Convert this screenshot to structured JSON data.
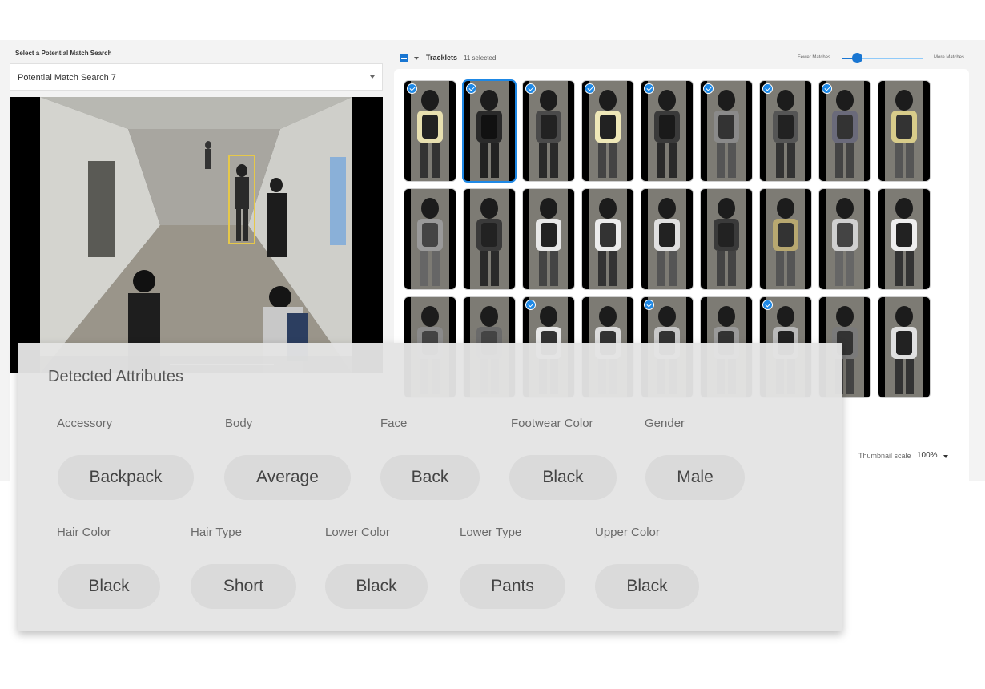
{
  "left_pane": {
    "select_label": "Select a Potential Match Search",
    "selected_search": "Potential Match Search 7"
  },
  "tracklets": {
    "title": "Tracklets",
    "selected_count": "11 selected",
    "fewer_label": "Fewer Matches",
    "more_label": "More Matches",
    "match_slider_level": 0.18,
    "thumbnail_scale_label": "Thumbnail scale",
    "thumbnail_scale_value": "100%",
    "thumbnails": [
      {
        "selected": true,
        "focused": false,
        "shirt": "#e8e0b0",
        "bag": "#222",
        "pants": "#333"
      },
      {
        "selected": true,
        "focused": true,
        "shirt": "#2a2a2a",
        "bag": "#111",
        "pants": "#222"
      },
      {
        "selected": true,
        "focused": false,
        "shirt": "#4a4a4a",
        "bag": "#222",
        "pants": "#2a2a2a"
      },
      {
        "selected": true,
        "focused": false,
        "shirt": "#efe8b8",
        "bag": "#222",
        "pants": "#444"
      },
      {
        "selected": true,
        "focused": false,
        "shirt": "#3a3a3a",
        "bag": "#1a1a1a",
        "pants": "#2a2a2a"
      },
      {
        "selected": true,
        "focused": false,
        "shirt": "#8a8a8a",
        "bag": "#333",
        "pants": "#555"
      },
      {
        "selected": true,
        "focused": false,
        "shirt": "#555",
        "bag": "#222",
        "pants": "#333"
      },
      {
        "selected": true,
        "focused": false,
        "shirt": "#6a6a7a",
        "bag": "#333",
        "pants": "#444"
      },
      {
        "selected": false,
        "focused": false,
        "shirt": "#d8cc8a",
        "bag": "#333",
        "pants": "#555"
      },
      {
        "selected": false,
        "focused": false,
        "shirt": "#9a9a9a",
        "bag": "#444",
        "pants": "#666"
      },
      {
        "selected": false,
        "focused": false,
        "shirt": "#3a3a3a",
        "bag": "#222",
        "pants": "#2a2a2a"
      },
      {
        "selected": false,
        "focused": false,
        "shirt": "#e8e8e8",
        "bag": "#222",
        "pants": "#444"
      },
      {
        "selected": false,
        "focused": false,
        "shirt": "#ececec",
        "bag": "#333",
        "pants": "#333"
      },
      {
        "selected": false,
        "focused": false,
        "shirt": "#e0e0e0",
        "bag": "#222",
        "pants": "#555"
      },
      {
        "selected": false,
        "focused": false,
        "shirt": "#3a3a3a",
        "bag": "#222",
        "pants": "#444"
      },
      {
        "selected": false,
        "focused": false,
        "shirt": "#b8a870",
        "bag": "#333",
        "pants": "#555"
      },
      {
        "selected": false,
        "focused": false,
        "shirt": "#d0d0d0",
        "bag": "#444",
        "pants": "#666"
      },
      {
        "selected": false,
        "focused": false,
        "shirt": "#eeeeee",
        "bag": "#222",
        "pants": "#333"
      },
      {
        "selected": false,
        "focused": false,
        "shirt": "#8a8a8a",
        "bag": "#444",
        "pants": "#555"
      },
      {
        "selected": false,
        "focused": false,
        "shirt": "#6a6a6a",
        "bag": "#444",
        "pants": "#555"
      },
      {
        "selected": true,
        "focused": false,
        "shirt": "#e8e8e8",
        "bag": "#333",
        "pants": "#444"
      },
      {
        "selected": false,
        "focused": false,
        "shirt": "#dcdcdc",
        "bag": "#333",
        "pants": "#555"
      },
      {
        "selected": true,
        "focused": false,
        "shirt": "#c8c8c8",
        "bag": "#333",
        "pants": "#444"
      },
      {
        "selected": false,
        "focused": false,
        "shirt": "#9a9a9a",
        "bag": "#333",
        "pants": "#444"
      },
      {
        "selected": true,
        "focused": false,
        "shirt": "#bababa",
        "bag": "#222",
        "pants": "#444"
      },
      {
        "selected": false,
        "focused": false,
        "shirt": "#7a7a7a",
        "bag": "#333",
        "pants": "#444"
      },
      {
        "selected": false,
        "focused": false,
        "shirt": "#e0e0e0",
        "bag": "#222",
        "pants": "#333"
      }
    ]
  },
  "attributes": {
    "title": "Detected Attributes",
    "row1": [
      {
        "label": "Accessory",
        "value": "Backpack"
      },
      {
        "label": "Body",
        "value": "Average"
      },
      {
        "label": "Face",
        "value": "Back"
      },
      {
        "label": "Footwear Color",
        "value": "Black"
      },
      {
        "label": "Gender",
        "value": "Male"
      }
    ],
    "row2": [
      {
        "label": "Hair Color",
        "value": "Black"
      },
      {
        "label": "Hair Type",
        "value": "Short"
      },
      {
        "label": "Lower Color",
        "value": "Black"
      },
      {
        "label": "Lower Type",
        "value": "Pants"
      },
      {
        "label": "Upper Color",
        "value": "Black"
      }
    ]
  },
  "colors": {
    "accent": "#1e88e5",
    "detection_box": "#e6c84a"
  }
}
